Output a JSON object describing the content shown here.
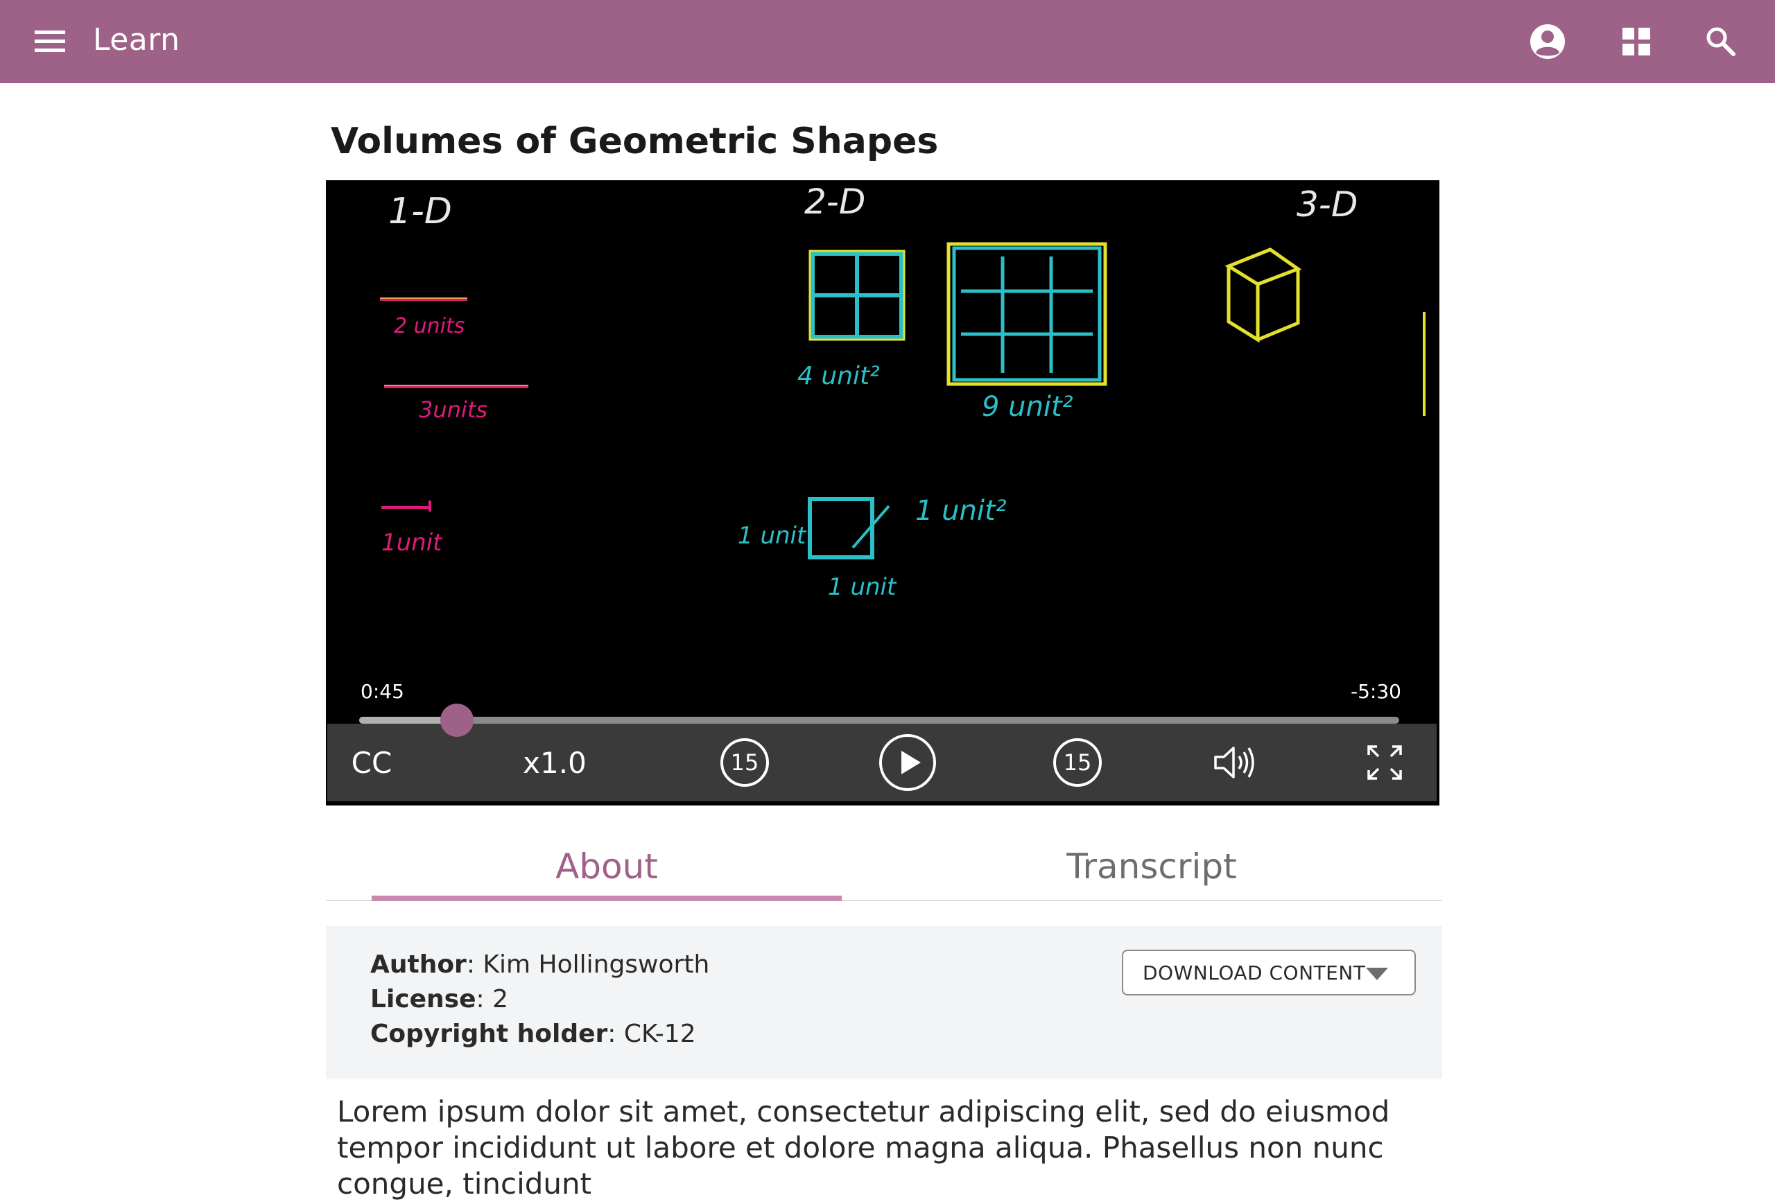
{
  "app": {
    "title": "Learn"
  },
  "header": {
    "icons": [
      "menu-icon",
      "account-icon",
      "apps-grid-icon",
      "search-icon"
    ]
  },
  "page": {
    "title": "Volumes of Geometric Shapes"
  },
  "video": {
    "board_labels": {
      "one_d": "1-D",
      "two_d": "2-D",
      "three_d": "3-D",
      "two_units": "2 units",
      "three_units": "3units",
      "one_unit": "1unit",
      "four_unit_sq": "4 unit²",
      "nine_unit_sq": "9 unit²",
      "one_unit_sq": "1 unit²",
      "side_unit_left": "1 unit",
      "side_unit_bottom": "1 unit"
    },
    "elapsed": "0:45",
    "remaining": "-5:30",
    "progress": 0.094,
    "controls": {
      "captions": "CC",
      "speed": "x1.0",
      "rewind_seconds": "15",
      "forward_seconds": "15"
    },
    "colors": {
      "pink": "#e0197d",
      "yellow": "#e3e12b",
      "cyan": "#2bc0c8",
      "chalk": "#e8e8e8"
    }
  },
  "tabs": [
    {
      "label": "About",
      "active": true
    },
    {
      "label": "Transcript",
      "active": false
    }
  ],
  "about": {
    "author_label": "Author",
    "author": "Kim Hollingsworth",
    "license_label": "License",
    "license": "2",
    "copyright_label": "Copyright holder",
    "copyright": "CK-12",
    "download_label": "DOWNLOAD CONTENT"
  },
  "description": "Lorem ipsum dolor sit amet, consectetur adipiscing elit, sed do eiusmod tempor incididunt ut labore et dolore magna aliqua. Phasellus non nunc congue, tincidunt",
  "theme": {
    "brand": "#9e6187",
    "tab_indicator": "#c98ab0"
  }
}
